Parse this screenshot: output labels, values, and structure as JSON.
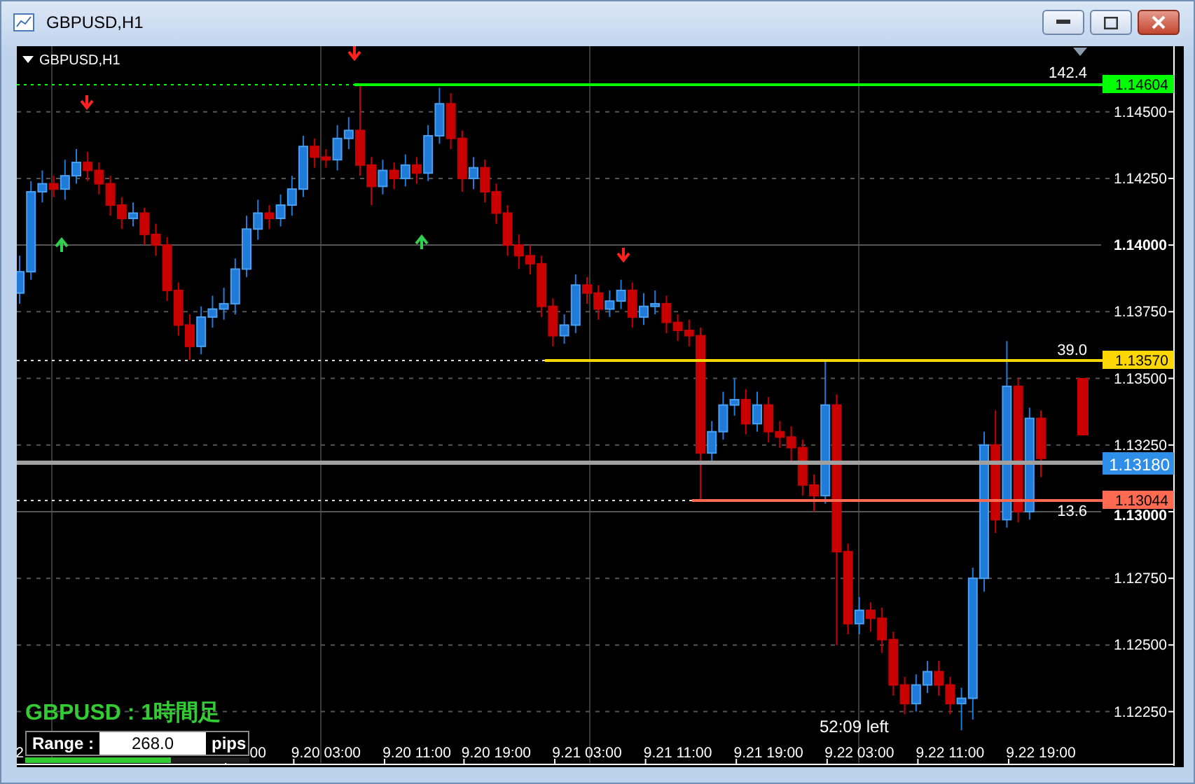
{
  "window": {
    "title": "GBPUSD,H1"
  },
  "chart": {
    "header": "GBPUSD,H1",
    "chart_data": {
      "type": "candlestick",
      "ylim": [
        1.12052,
        1.14746
      ],
      "grid": true,
      "yticks": [
        {
          "value": 1.145,
          "label": "1.14500"
        },
        {
          "value": 1.1425,
          "label": "1.14250"
        },
        {
          "value": 1.14,
          "label": "1.14000"
        },
        {
          "value": 1.1375,
          "label": "1.13750"
        },
        {
          "value": 1.135,
          "label": "1.13500"
        },
        {
          "value": 1.1325,
          "label": "1.13250"
        },
        {
          "value": 1.13,
          "label": "1.13000"
        },
        {
          "value": 1.1275,
          "label": "1.12750"
        },
        {
          "value": 1.125,
          "label": "1.12500"
        },
        {
          "value": 1.1225,
          "label": "1.12250"
        }
      ],
      "categories": [
        "2",
        null,
        null,
        null,
        null,
        null,
        null,
        null,
        null,
        null,
        null,
        null,
        null,
        null,
        null,
        null,
        null,
        null,
        null,
        null,
        null,
        "00",
        null,
        null,
        null,
        null,
        null,
        "9.20 03:00",
        null,
        null,
        null,
        null,
        null,
        null,
        null,
        "9.20 11:00",
        null,
        null,
        null,
        null,
        null,
        null,
        "9.20 19:00",
        null,
        null,
        null,
        null,
        null,
        null,
        null,
        "9.21 03:00",
        null,
        null,
        null,
        null,
        null,
        null,
        null,
        "9.21 11:00",
        null,
        null,
        null,
        null,
        null,
        null,
        null,
        "9.21 19:00",
        null,
        null,
        null,
        null,
        null,
        null,
        null,
        "9.22 03:00",
        null,
        null,
        null,
        null,
        null,
        null,
        null,
        "9.22 11:00",
        null,
        null,
        null,
        null,
        null,
        null,
        null,
        "9.22 19:00"
      ],
      "ohlc": [
        [
          1.1382,
          1.1396,
          1.1378,
          1.139
        ],
        [
          1.139,
          1.1424,
          1.1387,
          1.142
        ],
        [
          1.142,
          1.1428,
          1.1416,
          1.1423
        ],
        [
          1.1423,
          1.1426,
          1.1418,
          1.1421
        ],
        [
          1.1421,
          1.1432,
          1.1417,
          1.1426
        ],
        [
          1.1426,
          1.1436,
          1.1423,
          1.1431
        ],
        [
          1.1431,
          1.1435,
          1.1424,
          1.1428
        ],
        [
          1.1428,
          1.1431,
          1.1419,
          1.1423
        ],
        [
          1.1423,
          1.1426,
          1.1411,
          1.1415
        ],
        [
          1.1415,
          1.1418,
          1.1406,
          1.141
        ],
        [
          1.141,
          1.1416,
          1.1407,
          1.1412
        ],
        [
          1.1412,
          1.1414,
          1.14,
          1.1404
        ],
        [
          1.1404,
          1.1408,
          1.1396,
          1.14
        ],
        [
          1.14,
          1.1403,
          1.1379,
          1.1383
        ],
        [
          1.1383,
          1.1386,
          1.1366,
          1.137
        ],
        [
          1.137,
          1.1374,
          1.1357,
          1.1362
        ],
        [
          1.1362,
          1.1377,
          1.1359,
          1.1373
        ],
        [
          1.1373,
          1.1381,
          1.1369,
          1.1376
        ],
        [
          1.1376,
          1.1384,
          1.1372,
          1.1378
        ],
        [
          1.1378,
          1.1395,
          1.1374,
          1.1391
        ],
        [
          1.1391,
          1.1411,
          1.1388,
          1.1406
        ],
        [
          1.1406,
          1.1417,
          1.1402,
          1.1412
        ],
        [
          1.1412,
          1.1415,
          1.1406,
          1.141
        ],
        [
          1.141,
          1.1419,
          1.1407,
          1.1415
        ],
        [
          1.1415,
          1.1426,
          1.1411,
          1.1421
        ],
        [
          1.1421,
          1.1441,
          1.1418,
          1.1437
        ],
        [
          1.1437,
          1.144,
          1.1429,
          1.1433
        ],
        [
          1.1433,
          1.1436,
          1.1429,
          1.1432
        ],
        [
          1.1432,
          1.1445,
          1.1428,
          1.144
        ],
        [
          1.144,
          1.1448,
          1.1436,
          1.1443
        ],
        [
          1.1443,
          1.146,
          1.1426,
          1.143
        ],
        [
          1.143,
          1.1433,
          1.1415,
          1.1422
        ],
        [
          1.1422,
          1.1432,
          1.1419,
          1.1428
        ],
        [
          1.1428,
          1.1431,
          1.1421,
          1.1425
        ],
        [
          1.1425,
          1.1434,
          1.1422,
          1.143
        ],
        [
          1.143,
          1.1433,
          1.1423,
          1.1427
        ],
        [
          1.1427,
          1.1445,
          1.1424,
          1.1441
        ],
        [
          1.1441,
          1.1459,
          1.1438,
          1.1453
        ],
        [
          1.1453,
          1.1457,
          1.1436,
          1.144
        ],
        [
          1.144,
          1.1443,
          1.142,
          1.1425
        ],
        [
          1.1425,
          1.1433,
          1.1421,
          1.1429
        ],
        [
          1.1429,
          1.1432,
          1.1416,
          1.142
        ],
        [
          1.142,
          1.1423,
          1.1408,
          1.1412
        ],
        [
          1.1412,
          1.1415,
          1.1396,
          1.14
        ],
        [
          1.14,
          1.1404,
          1.1391,
          1.1396
        ],
        [
          1.1396,
          1.14,
          1.1389,
          1.1393
        ],
        [
          1.1393,
          1.1396,
          1.1373,
          1.1377
        ],
        [
          1.1377,
          1.138,
          1.1362,
          1.1366
        ],
        [
          1.1366,
          1.1374,
          1.1363,
          1.137
        ],
        [
          1.137,
          1.1389,
          1.1367,
          1.1385
        ],
        [
          1.1385,
          1.1388,
          1.1378,
          1.1382
        ],
        [
          1.1382,
          1.1385,
          1.1372,
          1.1376
        ],
        [
          1.1376,
          1.1383,
          1.1373,
          1.1379
        ],
        [
          1.1379,
          1.1387,
          1.1376,
          1.1383
        ],
        [
          1.1383,
          1.1386,
          1.1369,
          1.1373
        ],
        [
          1.1373,
          1.1382,
          1.137,
          1.1377
        ],
        [
          1.1377,
          1.1383,
          1.1374,
          1.1378
        ],
        [
          1.1378,
          1.1381,
          1.1367,
          1.1371
        ],
        [
          1.1371,
          1.1374,
          1.1364,
          1.1368
        ],
        [
          1.1368,
          1.1372,
          1.1362,
          1.1366
        ],
        [
          1.1366,
          1.1369,
          1.1304,
          1.1322
        ],
        [
          1.1322,
          1.1334,
          1.1318,
          1.133
        ],
        [
          1.133,
          1.1345,
          1.1327,
          1.134
        ],
        [
          1.134,
          1.135,
          1.1336,
          1.1342
        ],
        [
          1.1342,
          1.1346,
          1.1329,
          1.1333
        ],
        [
          1.1333,
          1.1345,
          1.133,
          1.134
        ],
        [
          1.134,
          1.1343,
          1.1326,
          1.133
        ],
        [
          1.133,
          1.1334,
          1.1324,
          1.1328
        ],
        [
          1.1328,
          1.1332,
          1.1319,
          1.1324
        ],
        [
          1.1324,
          1.1327,
          1.1306,
          1.131
        ],
        [
          1.131,
          1.1314,
          1.13,
          1.1306
        ],
        [
          1.1306,
          1.1357,
          1.1303,
          1.134
        ],
        [
          1.134,
          1.1344,
          1.125,
          1.1285
        ],
        [
          1.1285,
          1.1288,
          1.1254,
          1.1258
        ],
        [
          1.1258,
          1.1268,
          1.1254,
          1.1263
        ],
        [
          1.1263,
          1.1266,
          1.1255,
          1.126
        ],
        [
          1.126,
          1.1264,
          1.1247,
          1.1252
        ],
        [
          1.1252,
          1.1255,
          1.1231,
          1.1235
        ],
        [
          1.1235,
          1.1238,
          1.1224,
          1.1228
        ],
        [
          1.1228,
          1.1239,
          1.1225,
          1.1235
        ],
        [
          1.1235,
          1.1244,
          1.1232,
          1.124
        ],
        [
          1.124,
          1.1244,
          1.1231,
          1.1235
        ],
        [
          1.1235,
          1.1238,
          1.1224,
          1.1228
        ],
        [
          1.1228,
          1.1234,
          1.1218,
          1.123
        ],
        [
          1.123,
          1.1279,
          1.1222,
          1.1275
        ],
        [
          1.1275,
          1.133,
          1.127,
          1.1325
        ],
        [
          1.1325,
          1.1338,
          1.1292,
          1.1297
        ],
        [
          1.1297,
          1.1364,
          1.1294,
          1.1347
        ],
        [
          1.1347,
          1.135,
          1.1296,
          1.13
        ],
        [
          1.13,
          1.1339,
          1.1297,
          1.1335
        ],
        [
          1.1335,
          1.1338,
          1.1313,
          1.132
        ]
      ]
    },
    "price_label_major": [
      false,
      false,
      true,
      false,
      false,
      false,
      true,
      false,
      false,
      false
    ],
    "levels": [
      {
        "price": "1.14604",
        "distance": "142.4",
        "color": "#00ff00"
      },
      {
        "price": "1.13570",
        "distance": "39.0",
        "color": "#ffd700"
      },
      {
        "price": "1.13044",
        "distance": "13.6",
        "color": "#ff6a50"
      }
    ],
    "current_price": "1.13180",
    "signals": [
      {
        "kind": "sell"
      },
      {
        "kind": "sell"
      },
      {
        "kind": "sell"
      },
      {
        "kind": "buy"
      },
      {
        "kind": "buy"
      }
    ],
    "countdown": "52:09 left",
    "overlay_title": "GBPUSD : 1時間足",
    "range": {
      "label": "Range :",
      "value": "268.0",
      "unit": "pips",
      "level": 0.65
    }
  }
}
